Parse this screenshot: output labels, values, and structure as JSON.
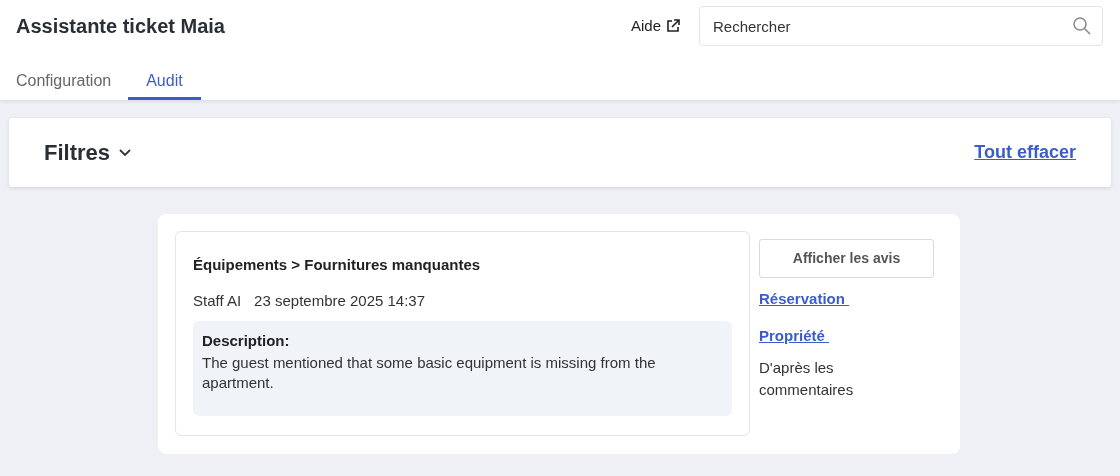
{
  "header": {
    "title": "Assistante ticket Maia",
    "help_link": "Aide"
  },
  "search": {
    "placeholder": "Rechercher"
  },
  "tabs": [
    {
      "label": "Configuration",
      "selected": false
    },
    {
      "label": "Audit",
      "selected": true
    }
  ],
  "filters": {
    "title": "Filtres",
    "clear": "Tout effacer"
  },
  "ticket": {
    "category": "Équipements > Fournitures manquantes",
    "author": "Staff AI",
    "date": "23 septembre 2025 14:37",
    "description_label": "Description:",
    "description": "The guest mentioned that some basic equipment is missing from the apartment.",
    "button": "Afficher les avis",
    "links": [
      "Réservation ",
      "Propriété "
    ],
    "note": "D'après les commentaires"
  }
}
